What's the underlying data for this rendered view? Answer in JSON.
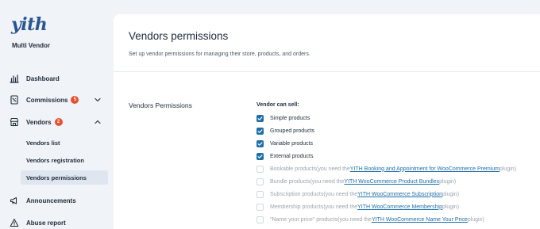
{
  "sidebar": {
    "logo_text": "yith",
    "brand": "Multi Vendor",
    "items": [
      {
        "label": "Dashboard",
        "icon": "chart-bar-icon"
      },
      {
        "label": "Commissions",
        "badge": "5",
        "icon": "receipt-icon"
      },
      {
        "label": "Vendors",
        "badge": "2",
        "icon": "store-icon"
      },
      {
        "label": "Announcements",
        "icon": "megaphone-icon"
      },
      {
        "label": "Abuse report",
        "icon": "warning-icon"
      }
    ],
    "sub_items": [
      {
        "label": "Vendors list"
      },
      {
        "label": "Vendors registration"
      },
      {
        "label": "Vendors permissions",
        "active": true
      }
    ]
  },
  "page": {
    "title": "Vendors permissions",
    "description": "Set up vendor permissions for managing their store, products, and orders."
  },
  "section": {
    "label": "Vendors Permissions",
    "field_heading": "Vendor can sell:",
    "options": [
      {
        "label": "Simple products",
        "checked": true
      },
      {
        "label": "Grouped products",
        "checked": true
      },
      {
        "label": "Variable products",
        "checked": true
      },
      {
        "label": "External products",
        "checked": true
      }
    ],
    "disabled_options": [
      {
        "label": "Bookable products",
        "pre": " (you need the ",
        "link": "YITH Booking and Appointment for WooCommerce Premium",
        "post": " plugin)"
      },
      {
        "label": "Bundle products",
        "pre": " (you need the ",
        "link": "YITH WooCommerce Product Bundles",
        "post": " plugin)"
      },
      {
        "label": "Subscription products",
        "pre": " (you need the ",
        "link": "YITH WooCommerce Subscription",
        "post": " plugin)"
      },
      {
        "label": "Membership products",
        "pre": " (you need the ",
        "link": "YITH WooCommerce Membership",
        "post": " plugin)"
      },
      {
        "label": "\"Name your price\" products",
        "pre": " (you need the ",
        "link": "YITH WooCommerce Name Your Price",
        "post": " plugin)"
      }
    ]
  },
  "colors": {
    "accent": "#1f6fa8",
    "badge": "#e8502d",
    "logo": "#2b5592"
  }
}
